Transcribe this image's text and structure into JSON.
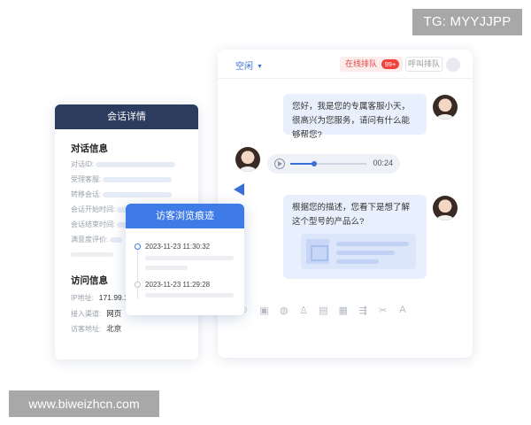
{
  "watermarks": {
    "top": "TG: MYYJJPP",
    "bottom": "www.biweizhcn.com"
  },
  "chat": {
    "status_label": "空闲",
    "queue_label": "在线排队",
    "queue_badge": "99+",
    "call_label": "呼叫排队",
    "messages": [
      {
        "text": "您好，我是您的专属客服小天，很高兴为您服务，请问有什么能够帮您?"
      },
      {
        "text": "根据您的描述，您看下是想了解这个型号的产品么?"
      }
    ],
    "voice": {
      "time": "00:24",
      "progress": 0.3
    },
    "toolbar_icons": [
      "emoji-icon",
      "image-icon",
      "history-icon",
      "user-icon",
      "document-icon",
      "screenshot-icon",
      "filter-icon",
      "scissors-icon",
      "font-icon"
    ]
  },
  "details": {
    "title": "会话详情",
    "conversation": {
      "title": "对话信息",
      "fields": [
        "对话ID:",
        "受理客服:",
        "转移会话:",
        "会话开始时间:",
        "会话结束时间:",
        "满意度评价:"
      ]
    },
    "visit": {
      "title": "访问信息",
      "ip_label": "IP地址:",
      "ip_value": "171.99.1",
      "channel_label": "接入渠道:",
      "channel_value": "网页",
      "location_label": "访客地址:",
      "location_value": "北京"
    }
  },
  "trail": {
    "title": "访客浏览痕迹",
    "entries": [
      {
        "time": "2023-11-23  11:30:32"
      },
      {
        "time": "2023-11-23  11:29:28"
      }
    ]
  },
  "colors": {
    "primary": "#3f7be6",
    "dark_header": "#2c3c5e",
    "bubble": "#e9f0fd",
    "badge": "#f0443a"
  }
}
